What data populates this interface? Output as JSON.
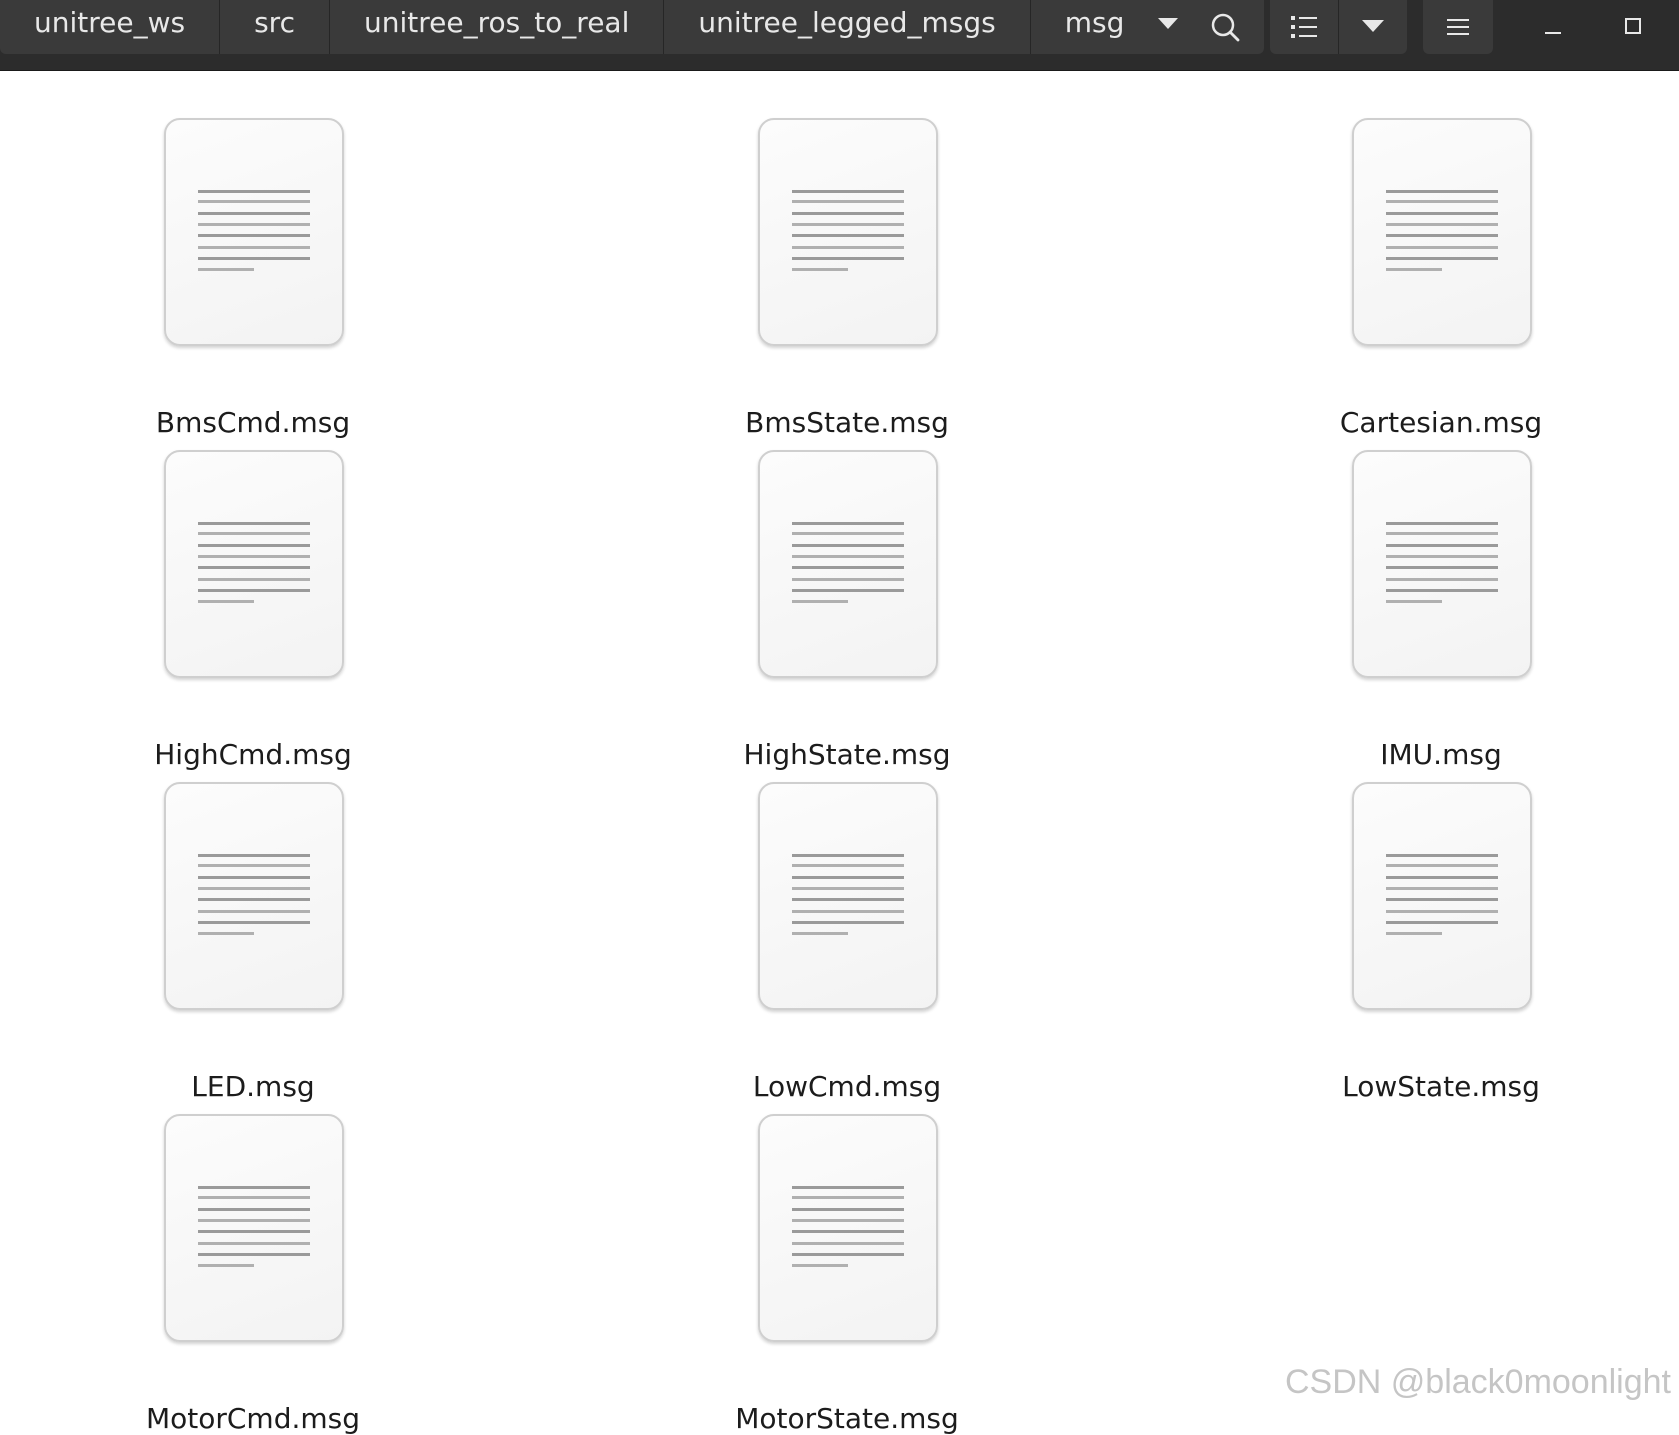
{
  "breadcrumbs": [
    {
      "label": "unitree_ws"
    },
    {
      "label": "src"
    },
    {
      "label": "unitree_ros_to_real"
    },
    {
      "label": "unitree_legged_msgs"
    },
    {
      "label": "msg"
    }
  ],
  "toolbar_icons": {
    "search": "search-icon",
    "view": "list-view-icon",
    "view_menu": "chevron-down-icon",
    "menu": "hamburger-menu-icon",
    "minimize": "minimize-icon",
    "maximize": "maximize-icon"
  },
  "files": [
    {
      "name": "BmsCmd.msg",
      "icon": "text-document-icon"
    },
    {
      "name": "BmsState.msg",
      "icon": "text-document-icon"
    },
    {
      "name": "Cartesian.msg",
      "icon": "text-document-icon"
    },
    {
      "name": "HighCmd.msg",
      "icon": "text-document-icon"
    },
    {
      "name": "HighState.msg",
      "icon": "text-document-icon"
    },
    {
      "name": "IMU.msg",
      "icon": "text-document-icon"
    },
    {
      "name": "LED.msg",
      "icon": "text-document-icon"
    },
    {
      "name": "LowCmd.msg",
      "icon": "text-document-icon"
    },
    {
      "name": "LowState.msg",
      "icon": "text-document-icon"
    },
    {
      "name": "MotorCmd.msg",
      "icon": "text-document-icon"
    },
    {
      "name": "MotorState.msg",
      "icon": "text-document-icon"
    }
  ],
  "watermark": "CSDN @black0moonlight",
  "colors": {
    "headerbar": "#2c2c2c",
    "button": "#3a3a3a",
    "background": "#ffffff"
  }
}
